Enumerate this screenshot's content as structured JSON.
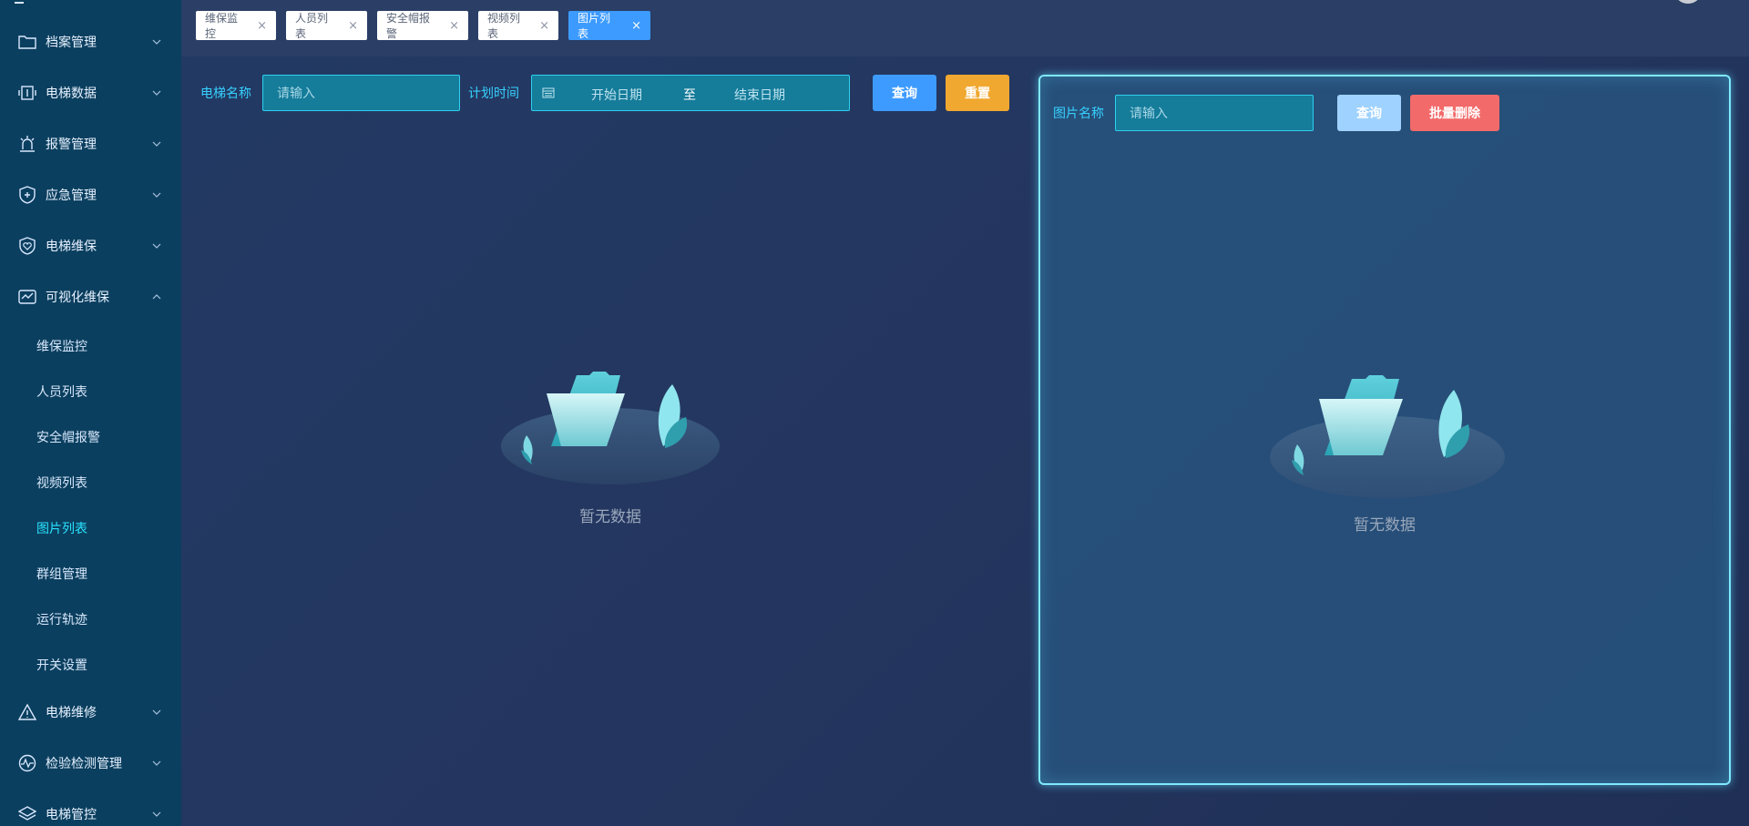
{
  "sidebar": {
    "items": [
      {
        "label": "档案管理",
        "icon": "folder-icon"
      },
      {
        "label": "电梯数据",
        "icon": "elevator-data-icon"
      },
      {
        "label": "报警管理",
        "icon": "alarm-icon"
      },
      {
        "label": "应急管理",
        "icon": "shield-plus-icon"
      },
      {
        "label": "电梯维保",
        "icon": "shield-heart-icon"
      },
      {
        "label": "可视化维保",
        "icon": "monitor-chart-icon"
      },
      {
        "label": "电梯维修",
        "icon": "warning-icon"
      },
      {
        "label": "检验检测管理",
        "icon": "pulse-icon"
      },
      {
        "label": "电梯管控",
        "icon": "layers-icon"
      }
    ],
    "submenu": [
      {
        "label": "维保监控"
      },
      {
        "label": "人员列表"
      },
      {
        "label": "安全帽报警"
      },
      {
        "label": "视频列表"
      },
      {
        "label": "图片列表"
      },
      {
        "label": "群组管理"
      },
      {
        "label": "运行轨迹"
      },
      {
        "label": "开关设置"
      }
    ]
  },
  "tabs": [
    {
      "label": "维保监控"
    },
    {
      "label": "人员列表"
    },
    {
      "label": "安全帽报警"
    },
    {
      "label": "视频列表"
    },
    {
      "label": "图片列表"
    }
  ],
  "tab_close": "×",
  "left_query": {
    "elevator_name_label": "电梯名称",
    "elevator_name_placeholder": "请输入",
    "plan_time_label": "计划时间",
    "start_date": "开始日期",
    "separator": "至",
    "end_date": "结束日期",
    "query_button": "查询",
    "reset_button": "重置"
  },
  "right_panel": {
    "picture_name_label": "图片名称",
    "picture_name_placeholder": "请输入",
    "query_button": "查询",
    "batch_delete_button": "批量删除"
  },
  "empty_text": "暂无数据",
  "colors": {
    "accent": "#3d9bff",
    "cyan": "#28e3ff",
    "reset": "#f0a830",
    "danger": "#f26a6a",
    "query_disabled": "#9fd2ff"
  }
}
